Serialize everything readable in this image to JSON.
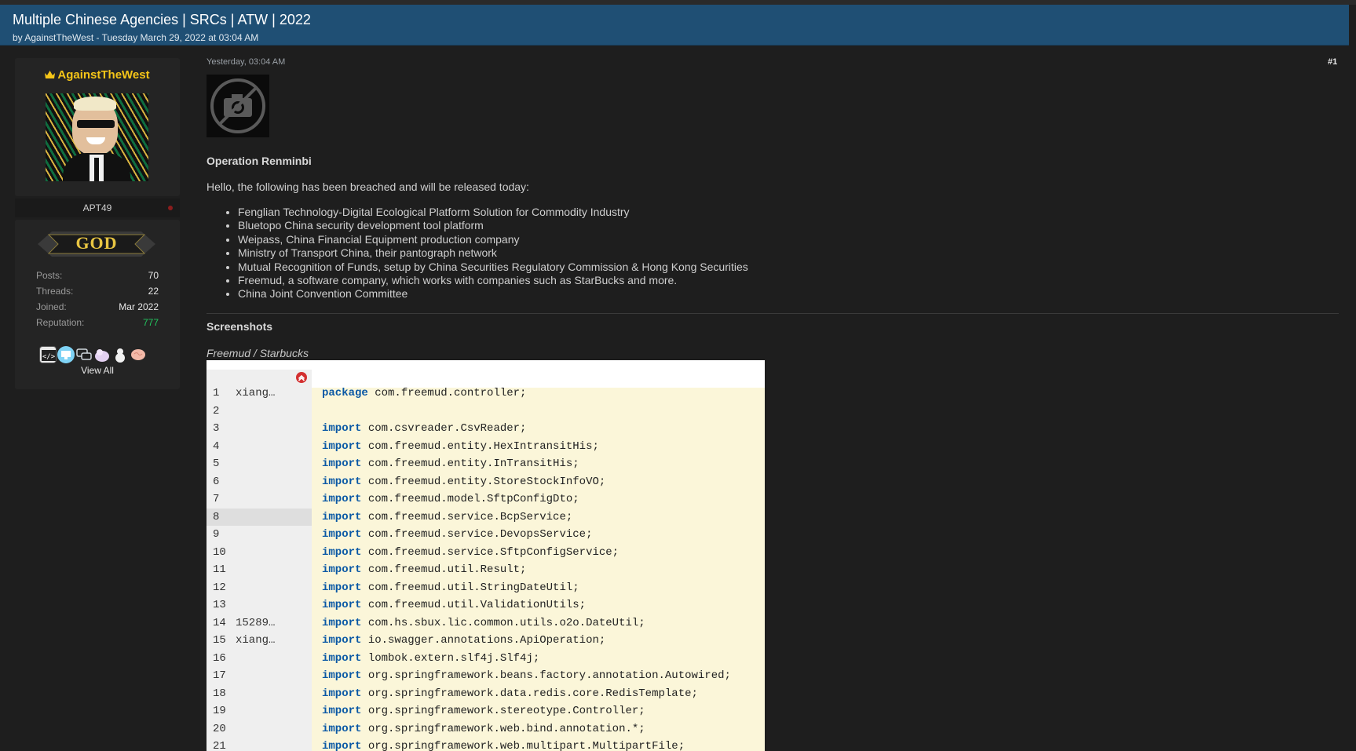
{
  "thread": {
    "title": "Multiple Chinese Agencies | SRCs | ATW | 2022",
    "meta": "by AgainstTheWest - Tuesday March 29, 2022 at 03:04 AM"
  },
  "user": {
    "name": "AgainstTheWest",
    "title": "APT49",
    "rank": "GOD",
    "stats": [
      {
        "label": "Posts:",
        "value": "70"
      },
      {
        "label": "Threads:",
        "value": "22"
      },
      {
        "label": "Joined:",
        "value": "Mar 2022"
      },
      {
        "label": "Reputation:",
        "value": "777"
      }
    ],
    "awards": [
      {
        "icon": "code-badge-icon",
        "color": "#e8e8e8"
      },
      {
        "icon": "monitor-badge-icon",
        "color": "#7fd3f5"
      },
      {
        "icon": "chat-badge-icon",
        "color": "#cfd6dc"
      },
      {
        "icon": "unicorn-badge-icon",
        "color": "#e5d2f3"
      },
      {
        "icon": "snowman-badge-icon",
        "color": "#f2f2f2"
      },
      {
        "icon": "brain-badge-icon",
        "color": "#f3b9a8"
      }
    ],
    "view_all": "View All"
  },
  "post": {
    "date": "Yesterday, 03:04 AM",
    "number": "#1",
    "heading": "Operation Renminbi",
    "intro": "Hello, the following has been breached and will be released today:",
    "items": [
      "Fenglian Technology-Digital Ecological Platform Solution for Commodity Industry",
      "Bluetopo China security development tool platform",
      "Weipass, China Financial Equipment production company",
      "Ministry of Transport China, their pantograph network",
      "Mutual Recognition of Funds, setup by China Securities Regulatory Commission & Hong Kong Securities",
      "Freemud, a software company, which works with companies such as StarBucks and more.",
      "China Joint Convention Committee"
    ],
    "screenshots_heading": "Screenshots",
    "caption": "Freemud / Starbucks"
  },
  "code": {
    "lines": [
      {
        "n": "1",
        "author": "xiang…",
        "kw": "package",
        "text": " com.freemud.controller;"
      },
      {
        "n": "2",
        "author": "",
        "kw": "",
        "text": ""
      },
      {
        "n": "3",
        "author": "",
        "kw": "import",
        "text": " com.csvreader.CsvReader;"
      },
      {
        "n": "4",
        "author": "",
        "kw": "import",
        "text": " com.freemud.entity.HexIntransitHis;"
      },
      {
        "n": "5",
        "author": "",
        "kw": "import",
        "text": " com.freemud.entity.InTransitHis;"
      },
      {
        "n": "6",
        "author": "",
        "kw": "import",
        "text": " com.freemud.entity.StoreStockInfoVO;"
      },
      {
        "n": "7",
        "author": "",
        "kw": "import",
        "text": " com.freemud.model.SftpConfigDto;"
      },
      {
        "n": "8",
        "author": "",
        "kw": "import",
        "text": " com.freemud.service.BcpService;"
      },
      {
        "n": "9",
        "author": "",
        "kw": "import",
        "text": " com.freemud.service.DevopsService;"
      },
      {
        "n": "10",
        "author": "",
        "kw": "import",
        "text": " com.freemud.service.SftpConfigService;"
      },
      {
        "n": "11",
        "author": "",
        "kw": "import",
        "text": " com.freemud.util.Result;"
      },
      {
        "n": "12",
        "author": "",
        "kw": "import",
        "text": " com.freemud.util.StringDateUtil;"
      },
      {
        "n": "13",
        "author": "",
        "kw": "import",
        "text": " com.freemud.util.ValidationUtils;"
      },
      {
        "n": "14",
        "author": "15289…",
        "kw": "import",
        "text": " com.hs.sbux.lic.common.utils.o2o.DateUtil;"
      },
      {
        "n": "15",
        "author": "xiang…",
        "kw": "import",
        "text": " io.swagger.annotations.ApiOperation;"
      },
      {
        "n": "16",
        "author": "",
        "kw": "import",
        "text": " lombok.extern.slf4j.Slf4j;"
      },
      {
        "n": "17",
        "author": "",
        "kw": "import",
        "text": " org.springframework.beans.factory.annotation.Autowired;"
      },
      {
        "n": "18",
        "author": "",
        "kw": "import",
        "text": " org.springframework.data.redis.core.RedisTemplate;"
      },
      {
        "n": "19",
        "author": "",
        "kw": "import",
        "text": " org.springframework.stereotype.Controller;"
      },
      {
        "n": "20",
        "author": "",
        "kw": "import",
        "text": " org.springframework.web.bind.annotation.*;"
      },
      {
        "n": "21",
        "author": "",
        "kw": "import",
        "text": " org.springframework.web.multipart.MultipartFile;"
      }
    ],
    "highlight_line": "8"
  }
}
